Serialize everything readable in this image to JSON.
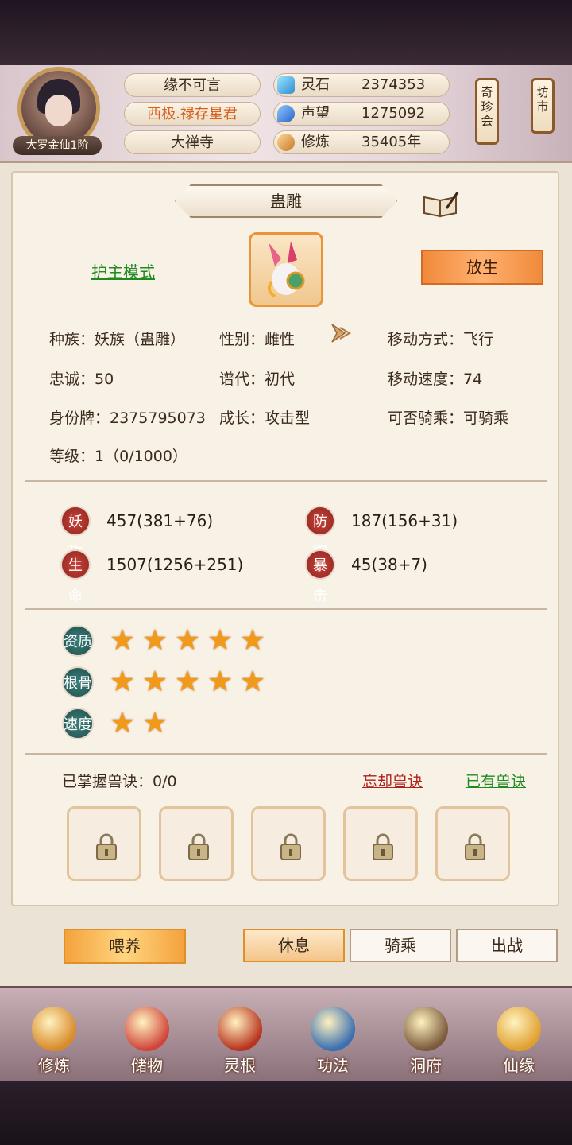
{
  "player": {
    "rank": "大罗金仙1阶",
    "info": [
      "缘不可言",
      "西极.禄存星君",
      "大禅寺"
    ]
  },
  "resources": [
    {
      "label": "灵石",
      "value": "2374353",
      "icon": "spirit-stone-icon",
      "color": "#4fb3e8"
    },
    {
      "label": "声望",
      "value": "1275092",
      "icon": "prestige-icon",
      "color": "#3d8ee0"
    },
    {
      "label": "修炼",
      "value": "35405年",
      "icon": "cultivation-icon",
      "color": "#e0a24a"
    }
  ],
  "side_buttons": [
    "奇珍会",
    "坊市"
  ],
  "pet": {
    "name": "蛊雕",
    "mode_link": "护主模式",
    "release_button": "放生",
    "info": [
      [
        "种族：妖族（蛊雕）",
        "性别：雌性",
        "移动方式：飞行"
      ],
      [
        "忠诚：50",
        "谱代：初代",
        "移动速度：74"
      ],
      [
        "身份牌：2375795073",
        "成长：攻击型",
        "可否骑乘：可骑乘"
      ],
      [
        "等级：1（0/1000）"
      ]
    ]
  },
  "stats": [
    {
      "label": "妖攻",
      "value": "457(381+76)"
    },
    {
      "label": "防御",
      "value": "187(156+31)"
    },
    {
      "label": "生命",
      "value": "1507(1256+251)"
    },
    {
      "label": "暴击",
      "value": "45(38+7)"
    }
  ],
  "qualities": [
    {
      "label": "资质",
      "stars": 5
    },
    {
      "label": "根骨",
      "stars": 5
    },
    {
      "label": "速度",
      "stars": 2
    }
  ],
  "skills": {
    "mastered": "已掌握兽诀：0/0",
    "forget_link": "忘却兽诀",
    "have_link": "已有兽诀",
    "slots": 5
  },
  "actions": {
    "feed": "喂养",
    "tabs": [
      "休息",
      "骑乘",
      "出战"
    ],
    "active_tab": 0
  },
  "nav": [
    {
      "label": "修炼",
      "icon": "cultivation-nav-icon",
      "color": "#d98a2a"
    },
    {
      "label": "储物",
      "icon": "storage-bag-icon",
      "color": "#d0453a"
    },
    {
      "label": "灵根",
      "icon": "spirit-root-icon",
      "color": "#b8341e"
    },
    {
      "label": "功法",
      "icon": "technique-book-icon",
      "color": "#3a6fb0"
    },
    {
      "label": "洞府",
      "icon": "cave-house-icon",
      "color": "#7a5a3a"
    },
    {
      "label": "仙缘",
      "icon": "fate-gourd-icon",
      "color": "#e0a030"
    }
  ]
}
